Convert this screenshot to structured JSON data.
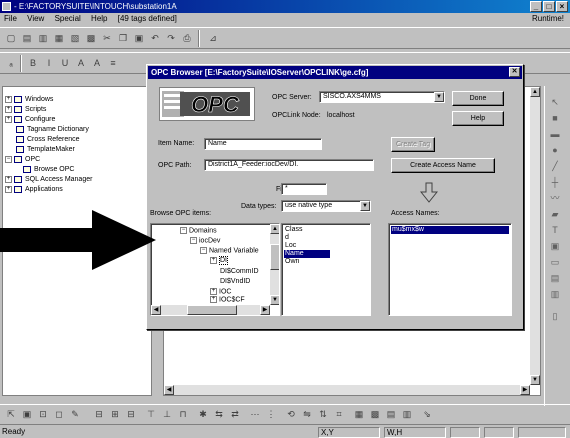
{
  "app": {
    "title": "- E:\\FACTORYSUITE\\INTOUCH\\substation1A",
    "menus": [
      "File",
      "View",
      "Special",
      "Help",
      "[49 tags defined]"
    ],
    "mode": "Runtime!",
    "status": {
      "ready": "Ready",
      "xy_label": "X,Y",
      "wh_label": "W,H"
    }
  },
  "tree": {
    "items": [
      {
        "label": "Windows",
        "icon": "window-icon"
      },
      {
        "label": "Scripts",
        "icon": "script-icon"
      },
      {
        "label": "Configure",
        "icon": "configure-icon"
      },
      {
        "label": "Tagname Dictionary",
        "icon": "dictionary-icon"
      },
      {
        "label": "Cross Reference",
        "icon": "cross-reference-icon"
      },
      {
        "label": "TemplateMaker",
        "icon": "template-icon"
      },
      {
        "label": "OPC",
        "icon": "opc-icon"
      },
      {
        "label": "Browse OPC",
        "icon": "browse-icon"
      },
      {
        "label": "SQL Access Manager",
        "icon": "sql-icon"
      },
      {
        "label": "Applications",
        "icon": "applications-icon"
      }
    ]
  },
  "dialog": {
    "title": "OPC Browser [E:\\FactorySuite\\IOServer\\OPCLINK\\ge.cfg]",
    "logo_text": "OPC",
    "server_label": "OPC Server:",
    "server_value": "SISCO.AXS4MMS",
    "node_label": "OPCLink Node:",
    "node_value": "localhost",
    "done_label": "Done",
    "help_label": "Help",
    "item_name_label": "Item Name:",
    "item_name_value": "Name",
    "opc_path_label": "OPC Path:",
    "opc_path_value": "District1A_Feeder:iocDev/DI.",
    "create_tag_label": "Create Tag",
    "create_access_label": "Create Access Name",
    "filter_label": "Filter:",
    "filter_value": "*",
    "datatypes_label": "Data types:",
    "datatypes_value": "use native type",
    "browse_label": "Browse OPC items:",
    "access_names_label": "Access Names:",
    "browse_tree": [
      "Domains",
      "iocDev",
      "Named Variable",
      "DI",
      "DI$CommID",
      "DI$VndID",
      "IOC",
      "IOC$CF"
    ],
    "items_list": [
      {
        "label": "Class",
        "selected": false
      },
      {
        "label": "d",
        "selected": false
      },
      {
        "label": "Loc",
        "selected": false
      },
      {
        "label": "Name",
        "selected": true
      },
      {
        "label": "Own",
        "selected": false
      }
    ],
    "access_names": [
      {
        "label": "mu$mx$w",
        "selected": true
      }
    ]
  }
}
